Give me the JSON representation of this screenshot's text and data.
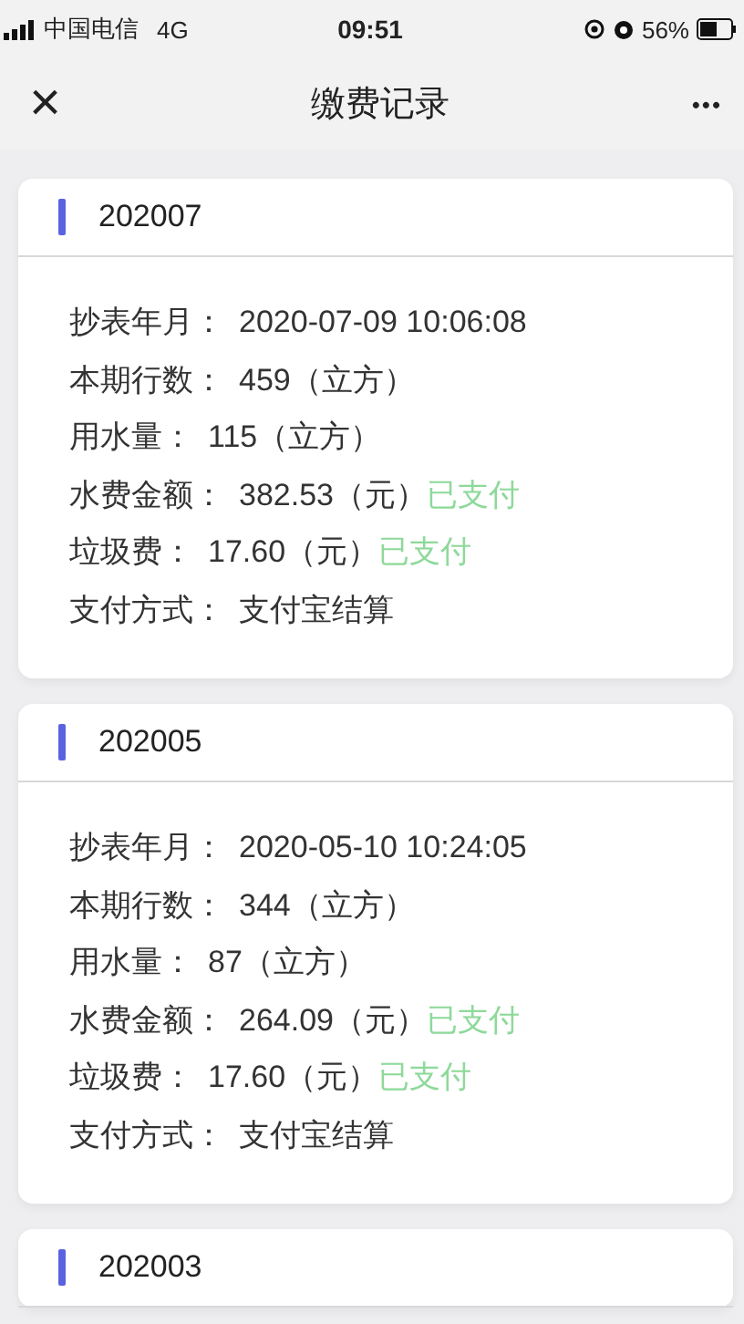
{
  "status_bar": {
    "carrier": "中国电信",
    "network": "4G",
    "time": "09:51",
    "battery": "56%"
  },
  "nav_bar": {
    "close": "×",
    "title": "缴费记录",
    "more": "•••"
  },
  "records": [
    {
      "period": "202007",
      "rows": [
        {
          "label": "抄表年月：",
          "value": "2020-07-09 10:06:08"
        },
        {
          "label": "本期行数：",
          "value": "459（立方）"
        },
        {
          "label": "用水量：",
          "value": "115（立方）"
        },
        {
          "label": "水费金额：",
          "value": "382.53（元）",
          "status": "已支付"
        },
        {
          "label": "垃圾费：",
          "value": "17.60（元）",
          "status": "已支付"
        },
        {
          "label": "支付方式：",
          "value": "支付宝结算"
        }
      ]
    },
    {
      "period": "202005",
      "rows": [
        {
          "label": "抄表年月：",
          "value": "2020-05-10 10:24:05"
        },
        {
          "label": "本期行数：",
          "value": "344（立方）"
        },
        {
          "label": "用水量：",
          "value": "87（立方）"
        },
        {
          "label": "水费金额：",
          "value": "264.09（元）",
          "status": "已支付"
        },
        {
          "label": "垃圾费：",
          "value": "17.60（元）",
          "status": "已支付"
        },
        {
          "label": "支付方式：",
          "value": "支付宝结算"
        }
      ]
    },
    {
      "period": "202003"
    }
  ]
}
